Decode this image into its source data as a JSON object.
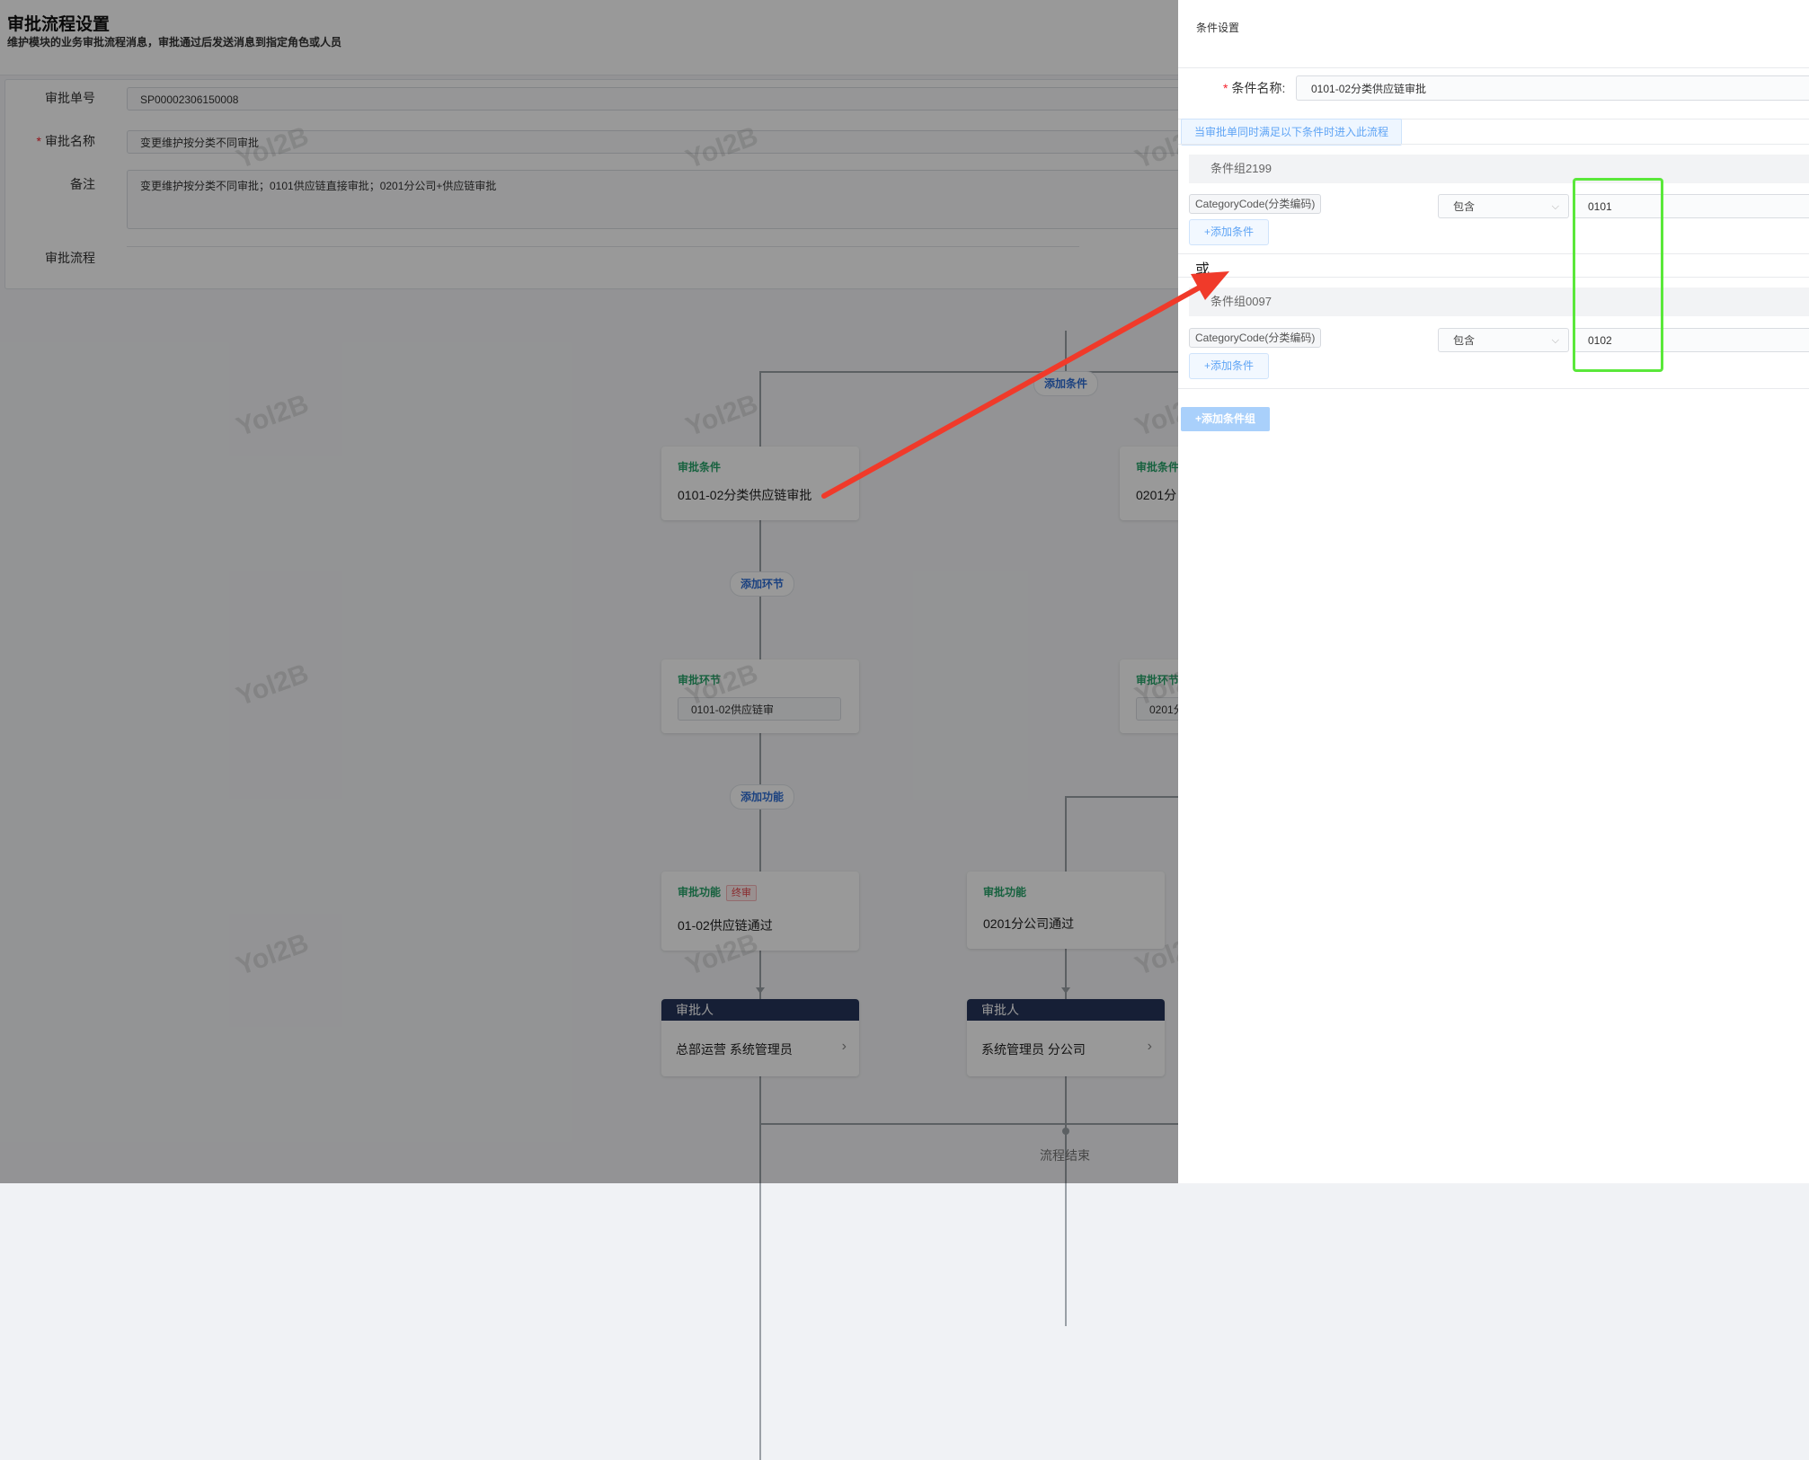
{
  "header": {
    "title": "审批流程设置",
    "subtitle": "维护模块的业务审批流程消息，审批通过后发送消息到指定角色或人员"
  },
  "form": {
    "number_label": "审批单号",
    "number_value": "SP00002306150008",
    "name_label": "审批名称",
    "name_value": "变更维护按分类不同审批",
    "remark_label": "备注",
    "remark_value": "变更维护按分类不同审批；0101供应链直接审批；0201分公司+供应链审批",
    "flow_label": "审批流程"
  },
  "flow": {
    "add_condition": "添加条件",
    "add_step": "添加环节",
    "add_function": "添加功能",
    "flow_end": "流程结束",
    "branches": [
      {
        "condition_tag": "审批条件",
        "condition_name": "0101-02分类供应链审批",
        "step_tag": "审批环节",
        "step_name": "0101-02供应链审",
        "function_tag": "审批功能",
        "function_badge": "终审",
        "function_name": "01-02供应链通过",
        "approver_title": "审批人",
        "approver_name": "总部运营 系统管理员"
      },
      {
        "condition_tag": "审批条件",
        "condition_name": "0201分",
        "step_tag": "审批环节",
        "step_name": "0201分"
      }
    ],
    "extra_function": {
      "tag": "审批功能",
      "name": "0201分公司通过",
      "approver_title": "审批人",
      "approver_name": "系统管理员 分公司"
    }
  },
  "watermark": "Yol2B",
  "drawer": {
    "title": "条件设置",
    "condition_name_label": "条件名称:",
    "condition_name_value": "0101-02分类供应链审批",
    "hint": "当审批单同时满足以下条件时进入此流程",
    "or_text": "或",
    "add_group": "+添加条件组",
    "groups": [
      {
        "name": "条件组2199",
        "field": "CategoryCode(分类编码)",
        "operator": "包含",
        "value": "0101",
        "add_condition": "+添加条件"
      },
      {
        "name": "条件组0097",
        "field": "CategoryCode(分类编码)",
        "operator": "包含",
        "value": "0102",
        "add_condition": "+添加条件"
      }
    ]
  },
  "colors": {
    "accent": "#2f6fd6",
    "condition_tag": "#27a36a",
    "approver_header": "#26355a",
    "highlight": "#5ae83a",
    "annotation_arrow": "#f03a2a"
  },
  "icons": {
    "approver_chevron": "chevron-right-icon",
    "select_chevron": "chevron-down-icon"
  }
}
